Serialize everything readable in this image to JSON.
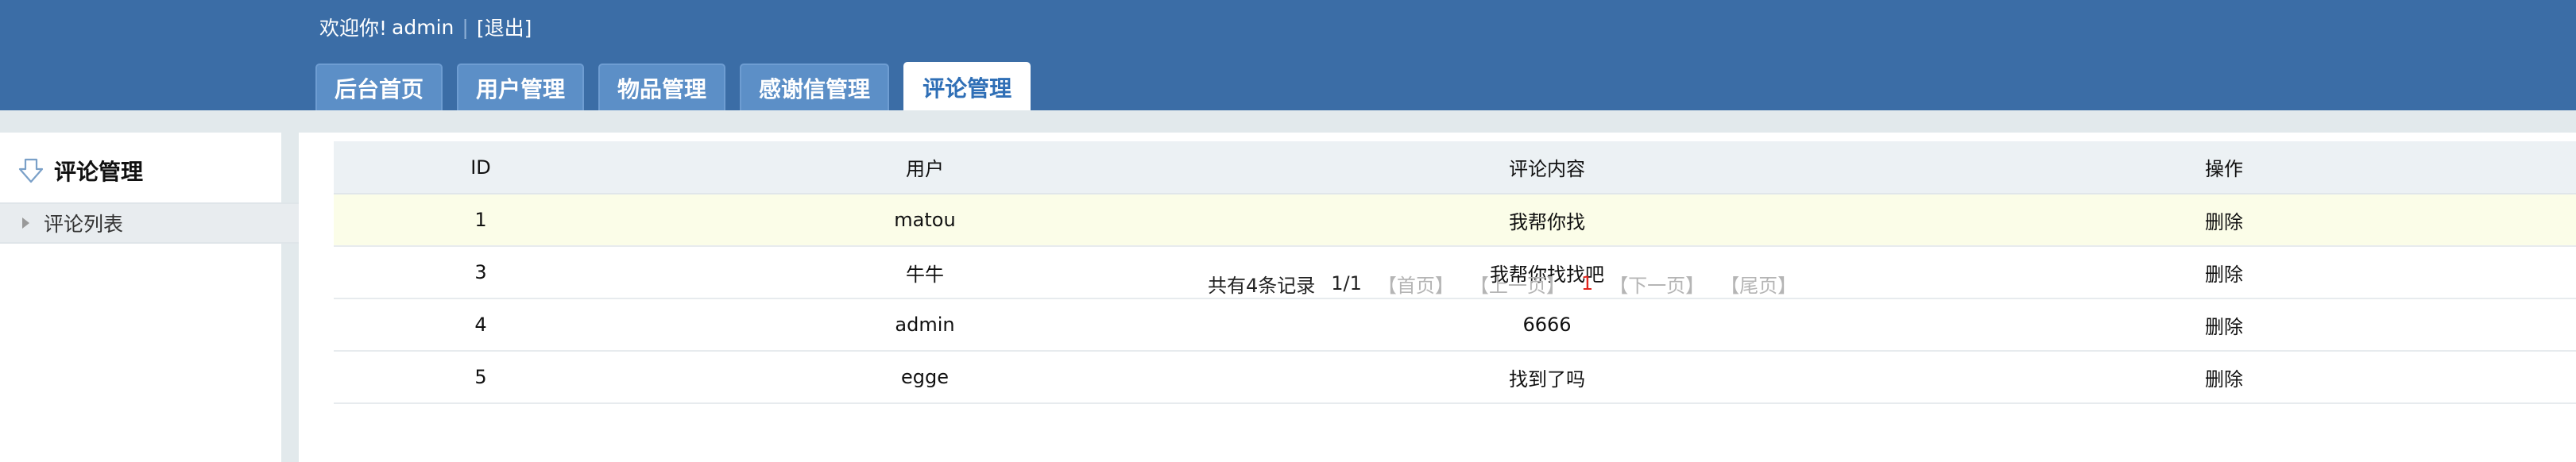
{
  "header": {
    "welcome_label": "欢迎你!",
    "username": "admin",
    "separator": "|",
    "logout_label": "[退出]",
    "tabs": [
      {
        "label": "后台首页"
      },
      {
        "label": "用户管理"
      },
      {
        "label": "物品管理"
      },
      {
        "label": "感谢信管理"
      },
      {
        "label": "评论管理"
      }
    ]
  },
  "sidebar": {
    "title": "评论管理",
    "items": [
      {
        "label": "评论列表"
      }
    ]
  },
  "table": {
    "columns": [
      "ID",
      "用户",
      "评论内容",
      "操作"
    ],
    "rows": [
      {
        "id": "1",
        "user": "matou",
        "content": "我帮你找",
        "action": "删除"
      },
      {
        "id": "3",
        "user": "牛牛",
        "content": "我帮你找找吧",
        "action": "删除"
      },
      {
        "id": "4",
        "user": "admin",
        "content": "6666",
        "action": "删除"
      },
      {
        "id": "5",
        "user": "egge",
        "content": "找到了吗",
        "action": "删除"
      }
    ]
  },
  "pager": {
    "total_label": "共有4条记录",
    "page_status": "1/1",
    "first": "【首页】",
    "prev": "【上一页】",
    "current": "1",
    "next": "【下一页】",
    "last": "【尾页】"
  },
  "colors": {
    "header_bg": "#3b6da6",
    "active_tab_text": "#2f6fb6",
    "highlight_row": "#fbfde8",
    "current_page": "#e0231b"
  }
}
